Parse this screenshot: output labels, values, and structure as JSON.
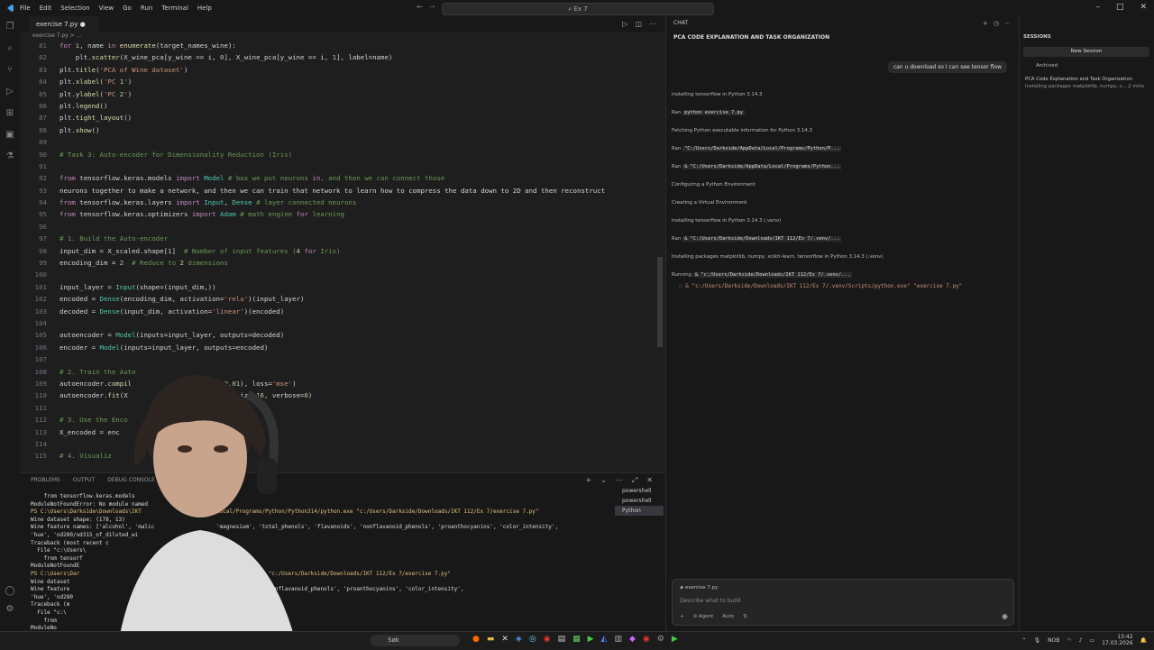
{
  "titlebar": {
    "menu": [
      "File",
      "Edit",
      "Selection",
      "View",
      "Go",
      "Run",
      "Terminal",
      "Help"
    ],
    "search": "Ex 7"
  },
  "tab": {
    "label": "exercise 7.py"
  },
  "breadcrumb": "exercise 7.py > ...",
  "code": [
    {
      "n": "81",
      "t": "for i, name in enumerate(target_names_wine):"
    },
    {
      "n": "82",
      "t": "    plt.scatter(X_wine_pca[y_wine == i, 0], X_wine_pca[y_wine == i, 1], label=name)"
    },
    {
      "n": "83",
      "t": "plt.title('PCA of Wine dataset')"
    },
    {
      "n": "84",
      "t": "plt.xlabel('PC 1')"
    },
    {
      "n": "85",
      "t": "plt.ylabel('PC 2')"
    },
    {
      "n": "86",
      "t": "plt.legend()"
    },
    {
      "n": "87",
      "t": "plt.tight_layout()"
    },
    {
      "n": "88",
      "t": "plt.show()"
    },
    {
      "n": "89",
      "t": ""
    },
    {
      "n": "90",
      "t": "# Task 3: Auto-encoder for Dimensionality Reduction (Iris)"
    },
    {
      "n": "91",
      "t": ""
    },
    {
      "n": "92",
      "t": "from tensorflow.keras.models import Model # box we put neurons in, and then we can connect those"
    },
    {
      "n": "93",
      "t": "neurons together to make a network, and then we can train that network to learn how to compress the data down to 2D and then reconstruct"
    },
    {
      "n": "94",
      "t": "from tensorflow.keras.layers import Input, Dense # layer connected neurons"
    },
    {
      "n": "95",
      "t": "from tensorflow.keras.optimizers import Adam # math engine for learning"
    },
    {
      "n": "96",
      "t": ""
    },
    {
      "n": "97",
      "t": "# 1. Build the Auto-encoder"
    },
    {
      "n": "98",
      "t": "input_dim = X_scaled.shape[1]  # Number of input features (4 for Iris)"
    },
    {
      "n": "99",
      "t": "encoding_dim = 2  # Reduce to 2 dimensions"
    },
    {
      "n": "100",
      "t": ""
    },
    {
      "n": "101",
      "t": "input_layer = Input(shape=(input_dim,))"
    },
    {
      "n": "102",
      "t": "encoded = Dense(encoding_dim, activation='relu')(input_layer)"
    },
    {
      "n": "103",
      "t": "decoded = Dense(input_dim, activation='linear')(encoded)"
    },
    {
      "n": "104",
      "t": ""
    },
    {
      "n": "105",
      "t": "autoencoder = Model(inputs=input_layer, outputs=decoded)"
    },
    {
      "n": "106",
      "t": "encoder = Model(inputs=input_layer, outputs=encoded)"
    },
    {
      "n": "107",
      "t": ""
    },
    {
      "n": "108",
      "t": "# 2. Train the Auto"
    },
    {
      "n": "109",
      "t": "autoencoder.compil                  rate=0.01), loss='mse')"
    },
    {
      "n": "110",
      "t": "autoencoder.fit(X                   , batch_size=16, verbose=0)"
    },
    {
      "n": "111",
      "t": ""
    },
    {
      "n": "112",
      "t": "# 3. Use the Enco"
    },
    {
      "n": "113",
      "t": "X_encoded = enc"
    },
    {
      "n": "114",
      "t": ""
    },
    {
      "n": "115",
      "t": "# 4. Visualiz"
    }
  ],
  "panel": {
    "tabs": [
      "PROBLEMS",
      "OUTPUT",
      "DEBUG CONSOLE"
    ],
    "terminal": [
      "    from tensorflow.keras.models",
      "ModuleNotFoundError: No module named",
      "PS C:\\Users\\Darkside\\Downloads\\IKT               AppData/Local/Programs/Python/Python314/python.exe \"c:/Users/Darkside/Downloads/IKT 112/Ex 7/exercise 7.py\"",
      "Wine dataset shape: (178, 13)",
      "Wine feature names: ['alcohol', 'malic                   'magnesium', 'total_phenols', 'flavanoids', 'nonflavanoid_phenols', 'proanthocyanins', 'color_intensity',",
      "'hue', 'od280/od315_of_diluted_wi",
      "Traceback (most recent c",
      "  File \"c:\\Users\\",
      "    from tensorf",
      "ModuleNotFoundE",
      "PS C:\\Users\\Dar                                           314/python.exe \"c:/Users/Darkside/Downloads/IKT 112/Ex 7/exercise 7.py\"",
      "Wine dataset",
      "Wine feature                                              'flavanoids', 'nonflavanoid_phenols', 'proanthocyanins', 'color_intensity',",
      "'hue', 'od280",
      "Traceback (m",
      "  File \"c:\\",
      "    from ",
      "ModuleNo"
    ],
    "terminals": [
      "powershell",
      "powershell",
      "Python"
    ]
  },
  "chat": {
    "header": "CHAT",
    "title": "PCA CODE EXPLANATION AND TASK ORGANIZATION",
    "user_message": "can u download so I can see tensor flow",
    "steps": [
      {
        "t": "Installing tensorflow in Python 3.14.3"
      },
      {
        "t": "Ran ",
        "c": "python exercise 7.py"
      },
      {
        "t": "Fetching Python executable information for Python 3.14.3"
      },
      {
        "t": "Ran ",
        "c": "\"C:/Users/Darkside/AppData/Local/Programs/Python/P..."
      },
      {
        "t": "Ran ",
        "c": "& \"C:/Users/Darkside/AppData/Local/Programs/Python..."
      },
      {
        "t": "Configuring a Python Environment"
      },
      {
        "t": "Creating a Virtual Environment"
      },
      {
        "t": "Installing tensorflow in Python 3.14.3 (.venv)"
      },
      {
        "t": "Ran ",
        "c": "& \"C:/Users/Darkside/Downloads/IKT 112/Ex 7/.venv/..."
      },
      {
        "t": "Installing packages matplotlib, numpy, scikit-learn, tensorflow in Python 3.14.3 (.venv)"
      },
      {
        "t": "Running ",
        "c": "& \"c:/Users/Darkside/Downloads/IKT 112/Ex 7/.venv/..."
      }
    ],
    "running_cmd": "& \"c:/Users/Darkside/Downloads/IKT 112/Ex 7/.venv/Scripts/python.exe\" \"exercise 7.py\"",
    "input": {
      "file_chip": "exercise 7.py",
      "placeholder": "Describe what to build",
      "agent": "Agent",
      "auto": "Auto"
    }
  },
  "sessions": {
    "title": "SESSIONS",
    "new_button": "New Session",
    "archived": "Archived",
    "item_title": "PCA Code Explanation and Task Organization",
    "item_sub": "Installing packages matplotlib, numpy, s... 2 mins"
  },
  "taskbar": {
    "search": "Søk",
    "lang": "NOB",
    "time": "13:42",
    "date": "17.03.2026"
  },
  "colors": {
    "accent": "#007acc",
    "bg": "#1e1e1e",
    "sidebar": "#181818"
  }
}
